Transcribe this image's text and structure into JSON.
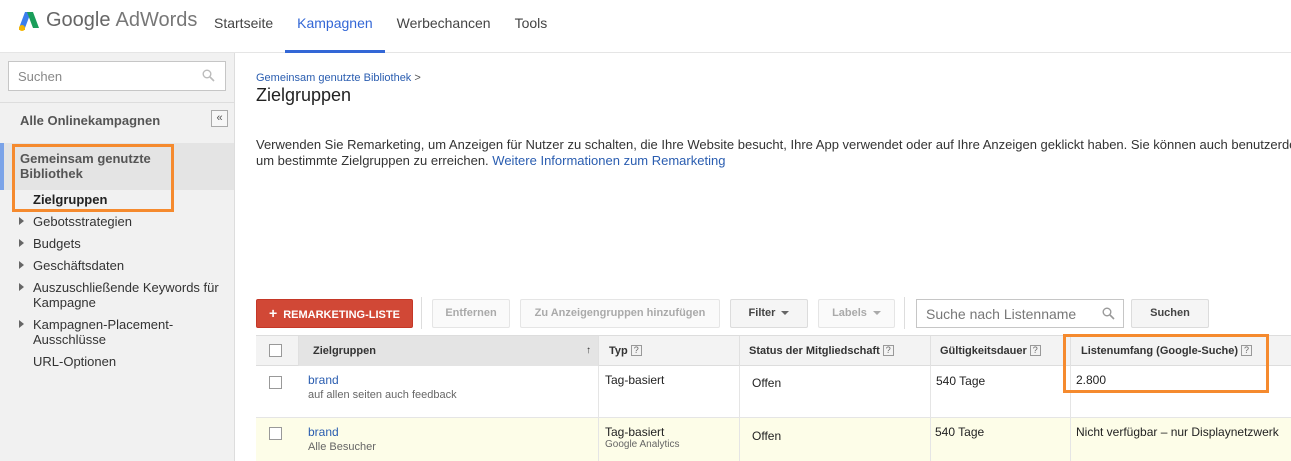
{
  "header": {
    "logo_google": "Google",
    "logo_product": "AdWords",
    "nav": [
      {
        "label": "Startseite"
      },
      {
        "label": "Kampagnen"
      },
      {
        "label": "Werbechancen"
      },
      {
        "label": "Tools"
      }
    ]
  },
  "sidebar": {
    "search_placeholder": "Suchen",
    "all_campaigns": "Alle Onlinekampagnen",
    "collapse": "«",
    "shared_library": "Gemeinsam genutzte Bibliothek",
    "items": [
      {
        "label": "Zielgruppen"
      },
      {
        "label": "Gebotsstrategien"
      },
      {
        "label": "Budgets"
      },
      {
        "label": "Geschäftsdaten"
      },
      {
        "label": "Auszuschließende Keywords für Kampagne"
      },
      {
        "label": "Kampagnen-Placement-Ausschlüsse"
      },
      {
        "label": "URL-Optionen"
      }
    ]
  },
  "main": {
    "breadcrumb": "Gemeinsam genutzte Bibliothek",
    "breadcrumb_sep": ">",
    "title": "Zielgruppen",
    "description_line1": "Verwenden Sie Remarketing, um Anzeigen für Nutzer zu schalten, die Ihre Website besucht, Ihre App verwendet oder auf Ihre Anzeigen geklickt haben. Sie können auch benutzerdef",
    "description_line2": "um bestimmte Zielgruppen zu erreichen.",
    "description_link": "Weitere Informationen zum Remarketing"
  },
  "toolbar": {
    "remarketing_plus": "+",
    "remarketing": "REMARKETING-LISTE",
    "remove": "Entfernen",
    "add_to_adgroups": "Zu Anzeigengruppen hinzufügen",
    "filter": "Filter",
    "labels": "Labels",
    "search_placeholder": "Suche nach Listenname",
    "search_button": "Suchen"
  },
  "table": {
    "headers": {
      "audiences": "Zielgruppen",
      "sort": "↑",
      "type": "Typ",
      "status": "Status der Mitgliedschaft",
      "duration": "Gültigkeitsdauer",
      "size": "Listenumfang (Google-Suche)",
      "help": "?"
    },
    "rows": [
      {
        "name": "brand",
        "desc": "auf allen seiten auch feedback",
        "type": "Tag-basiert",
        "type_sub": "",
        "status": "Offen",
        "duration": "540 Tage",
        "size": "2.800"
      },
      {
        "name": "brand",
        "desc": "Alle Besucher",
        "type": "Tag-basiert",
        "type_sub": "Google Analytics",
        "status": "Offen",
        "duration": "540 Tage",
        "size": "Nicht verfügbar – nur Displaynetzwerk"
      }
    ]
  },
  "colors": {
    "accent": "#3367d6",
    "primary_button": "#d14836",
    "highlight": "#f58a2e",
    "link": "#2a5db0"
  }
}
